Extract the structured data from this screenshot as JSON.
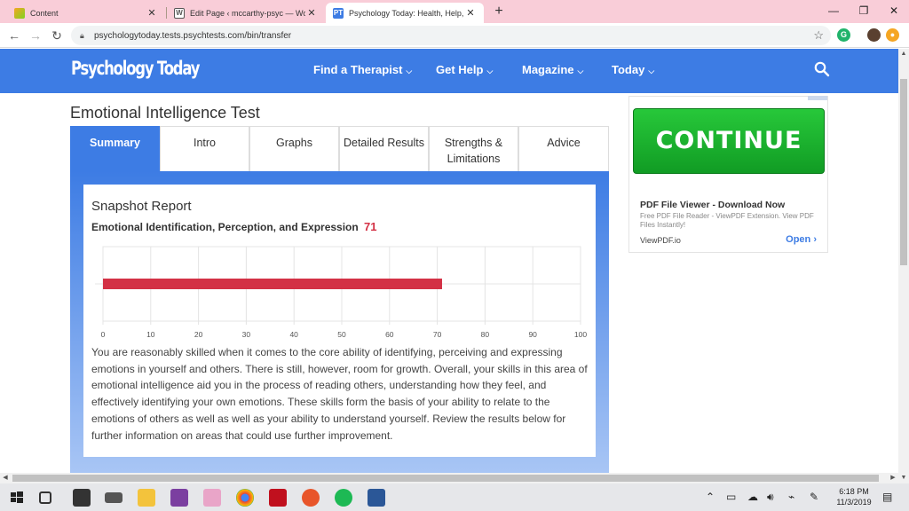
{
  "browser": {
    "tabs": [
      {
        "title": "Content",
        "favicon_color": "#f5a623",
        "active": false
      },
      {
        "title": "Edit Page ‹ mccarthy-psyc — Wo",
        "favicon_color": "#ffffff",
        "active": false
      },
      {
        "title": "Psychology Today: Health, Help, I",
        "favicon_color": "#3d7ce4",
        "favicon_text": "PT",
        "active": true
      }
    ],
    "url": "psychologytoday.tests.psychtests.com/bin/transfer"
  },
  "site": {
    "logo": "Psychology Today",
    "nav": [
      {
        "label": "Find a Therapist"
      },
      {
        "label": "Get Help"
      },
      {
        "label": "Magazine"
      },
      {
        "label": "Today"
      }
    ]
  },
  "main": {
    "title": "Emotional Intelligence Test",
    "tabs": [
      {
        "label": "Summary",
        "active": true
      },
      {
        "label": "Intro"
      },
      {
        "label": "Graphs"
      },
      {
        "label": "Detailed Results"
      },
      {
        "label": "Strengths & Limitations"
      },
      {
        "label": "Advice"
      }
    ],
    "report": {
      "title": "Snapshot Report",
      "subtitle": "Emotional Identification, Perception, and Expression",
      "score": "71",
      "description": "You are reasonably skilled when it comes to the core ability of identifying, perceiving and expressing emotions in yourself and others. There is still, however, room for growth. Overall, your skills in this area of emotional intelligence aid you in the process of reading others, understanding how they feel, and effectively identifying your own emotions. These skills form the basis of your ability to relate to the emotions of others as well as well as your ability to understand yourself. Review the results below for further information on areas that could use further improvement."
    }
  },
  "chart_data": {
    "type": "bar",
    "orientation": "horizontal",
    "categories": [
      ""
    ],
    "values": [
      71
    ],
    "xlim": [
      0,
      100
    ],
    "xticks": [
      0,
      10,
      20,
      30,
      40,
      50,
      60,
      70,
      80,
      90,
      100
    ],
    "bar_color": "#d33145",
    "grid": true
  },
  "ad": {
    "cta": "CONTINUE",
    "title": "PDF File Viewer - Download Now",
    "description": "Free PDF File Reader - ViewPDF Extension. View PDF Files Instantly!",
    "domain": "ViewPDF.io",
    "open": "Open"
  },
  "taskbar": {
    "time": "6:18 PM",
    "date": "11/3/2019"
  }
}
